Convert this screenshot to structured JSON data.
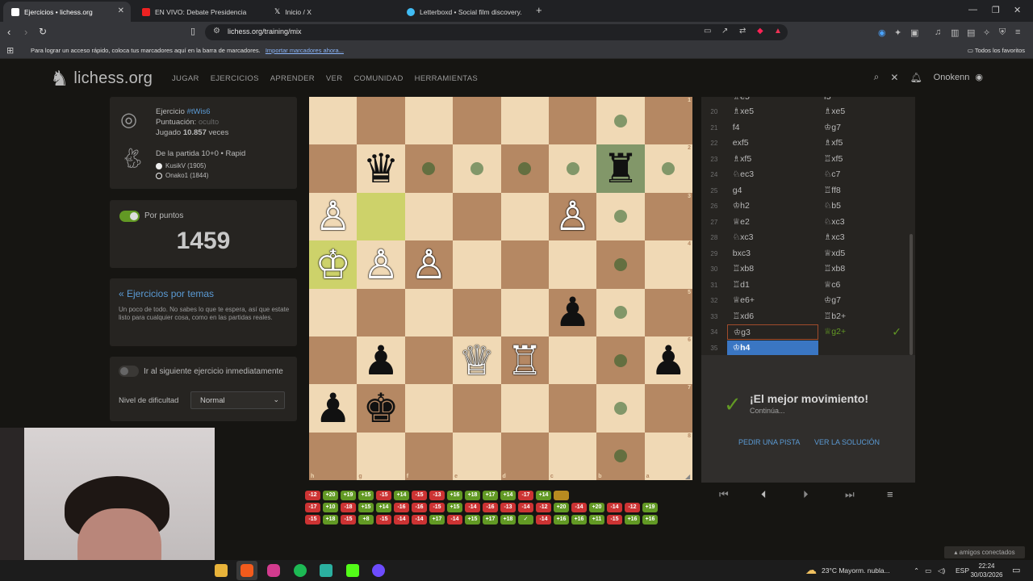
{
  "browser": {
    "tabs": [
      {
        "title": "Ejercicios • lichess.org",
        "active": true
      },
      {
        "title": "EN VIVO: Debate Presidencia",
        "active": false
      },
      {
        "title": "Inicio / X",
        "active": false
      },
      {
        "title": "Letterboxd • Social film discovery.",
        "active": false
      }
    ],
    "url": "lichess.org/training/mix",
    "bookmarks_message": "Para lograr un acceso rápido, coloca tus marcadores aquí en la barra de marcadores.",
    "bookmarks_link": "Importar marcadores ahora...",
    "all_bookmarks": "Todos los favoritos"
  },
  "site": {
    "logo": "lichess.org",
    "nav": [
      "JUGAR",
      "EJERCICIOS",
      "APRENDER",
      "VER",
      "COMUNIDAD",
      "HERRAMIENTAS"
    ],
    "username": "Onokenn"
  },
  "puzzle": {
    "label": "Ejercicio",
    "id": "#tWis6",
    "rating_label": "Puntuación:",
    "rating_value": "oculto",
    "played_label": "Jugado",
    "played_count": "10.857",
    "played_suffix": "veces",
    "game_from": "De la partida 10+0 • Rapid",
    "white_player": "KusikV (1905)",
    "black_player": "Onako1 (1844)"
  },
  "rating_box": {
    "toggle_label": "Por puntos",
    "toggle_on": true,
    "rating": "1459"
  },
  "themes": {
    "link": "« Ejercicios por temas",
    "description": "Un poco de todo. No sabes lo que te espera, así que estate listo para cualquier cosa, como en las partidas reales."
  },
  "settings": {
    "next_label": "Ir al siguiente ejercicio inmediatamente",
    "next_on": false,
    "difficulty_label": "Nivel de dificultad",
    "difficulty_value": "Normal"
  },
  "board": {
    "orientation": "black",
    "ranks": [
      "1",
      "2",
      "3",
      "4",
      "5",
      "6",
      "7",
      "8"
    ],
    "files": [
      "h",
      "g",
      "f",
      "e",
      "d",
      "c",
      "b",
      "a"
    ],
    "rows": [
      [
        "",
        "",
        "",
        "",
        "",
        "",
        "",
        ""
      ],
      [
        "",
        "bq",
        "",
        "",
        "",
        "",
        "br",
        ""
      ],
      [
        "wp",
        "",
        "",
        "",
        "",
        "wp",
        "",
        ""
      ],
      [
        "wk",
        "wp",
        "wp",
        "",
        "",
        "",
        "",
        ""
      ],
      [
        "",
        "",
        "",
        "",
        "",
        "bp",
        "",
        ""
      ],
      [
        "",
        "bp",
        "",
        "wq",
        "wr",
        "",
        "",
        "bp"
      ],
      [
        "bp",
        "bk",
        "",
        "",
        "",
        "",
        "",
        ""
      ],
      [
        "",
        "",
        "",
        "",
        "",
        "",
        "",
        ""
      ]
    ]
  },
  "moves": [
    {
      "num": "20",
      "white": "♗xe5",
      "black": "♗xe5"
    },
    {
      "num": "21",
      "white": "f4",
      "black": "♔g7"
    },
    {
      "num": "22",
      "white": "exf5",
      "black": "♗xf5"
    },
    {
      "num": "23",
      "white": "♗xf5",
      "black": "♖xf5"
    },
    {
      "num": "24",
      "white": "♘ec3",
      "black": "♘c7"
    },
    {
      "num": "25",
      "white": "g4",
      "black": "♖ff8"
    },
    {
      "num": "26",
      "white": "♔h2",
      "black": "♘b5"
    },
    {
      "num": "27",
      "white": "♕e2",
      "black": "♘xc3"
    },
    {
      "num": "28",
      "white": "♘xc3",
      "black": "♗xc3"
    },
    {
      "num": "29",
      "white": "bxc3",
      "black": "♕xd5"
    },
    {
      "num": "30",
      "white": "♖xb8",
      "black": "♖xb8"
    },
    {
      "num": "31",
      "white": "♖d1",
      "black": "♕c6"
    },
    {
      "num": "32",
      "white": "♕e6+",
      "black": "♔g7"
    },
    {
      "num": "33",
      "white": "♖xd6",
      "black": "♖b2+"
    },
    {
      "num": "34",
      "white": "♔g3",
      "black": "♕g2+"
    },
    {
      "num": "35",
      "white": "♔h4",
      "black": ""
    }
  ],
  "moves_top_partial": {
    "white": "♗e5",
    "black": "f5"
  },
  "feedback": {
    "title": "¡El mejor movimiento!",
    "subtitle": "Continúa...",
    "hint_button": "PEDIR UNA PISTA",
    "solution_button": "VER LA SOLUCIÓN"
  },
  "streak": [
    [
      "-12",
      "+20",
      "+19",
      "+15",
      "-15",
      "+14",
      "-15",
      "-13",
      "+16",
      "+18",
      "+17",
      "+14",
      "-17",
      "+14",
      ""
    ],
    [
      "-17",
      "+10",
      "-18",
      "+15",
      "+14",
      "-16",
      "-16",
      "-15",
      "+15",
      "-14",
      "-16",
      "-13",
      "-14",
      "-12",
      "+20",
      "-14",
      "+20",
      "-14",
      "-12",
      "+19"
    ],
    [
      "-15",
      "+18",
      "-15",
      "+8",
      "-15",
      "-14",
      "-14",
      "+17",
      "-14",
      "+15",
      "+17",
      "+18",
      "✓",
      "-14",
      "+16",
      "+16",
      "+11",
      "-15",
      "+16",
      "+16"
    ]
  ],
  "friends": "amigos conectados",
  "taskbar": {
    "weather": "23°C  Mayorm. nubla...",
    "lang": "ESP",
    "time": "22:24",
    "date": "30/03/2026"
  },
  "colors": {
    "accent": "#629924",
    "link": "#5b9bd5",
    "current_move": "#3a76c3"
  }
}
